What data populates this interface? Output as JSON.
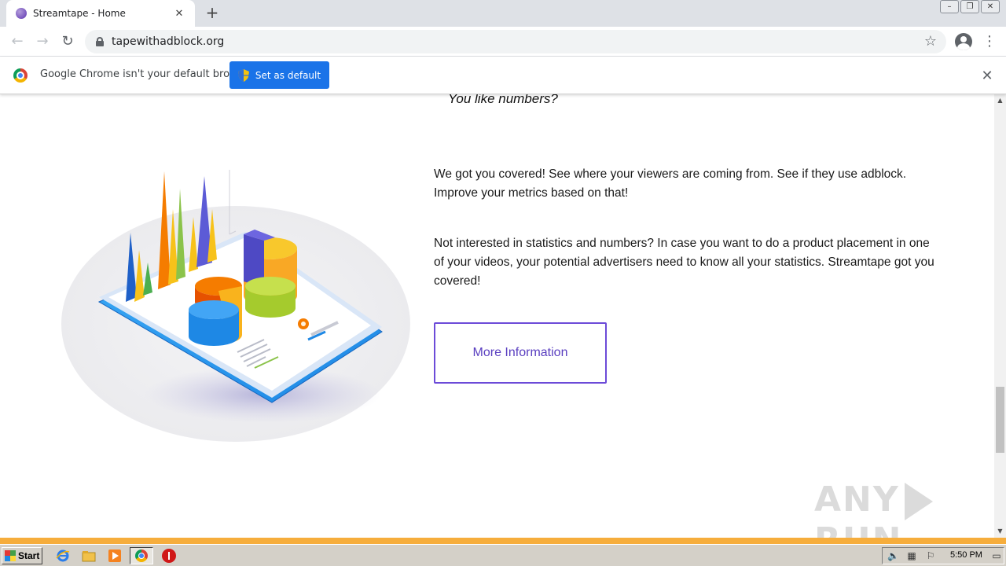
{
  "browser": {
    "tab": {
      "title": "Streamtape - Home",
      "close_icon": "close-icon"
    },
    "new_tab_label": "+",
    "url": "tapewithadblock.org",
    "infobar": {
      "message": "Google Chrome isn't your default browser",
      "button_label": "Set as default"
    }
  },
  "page": {
    "heading": "You like numbers?",
    "paragraph1": "We got you covered! See where your viewers are coming from. See if they use adblock. Improve your metrics based on that!",
    "paragraph2": "Not interested in statistics and numbers? In case you want to do a product placement in one of your videos, your potential advertisers need to know all your statistics. Streamtape got you covered!",
    "more_button": "More Information",
    "accent_color": "#6c4bd8"
  },
  "watermark": {
    "left": "ANY",
    "right": "RUN"
  },
  "taskbar": {
    "start_label": "Start",
    "clock": "5:50 PM"
  }
}
